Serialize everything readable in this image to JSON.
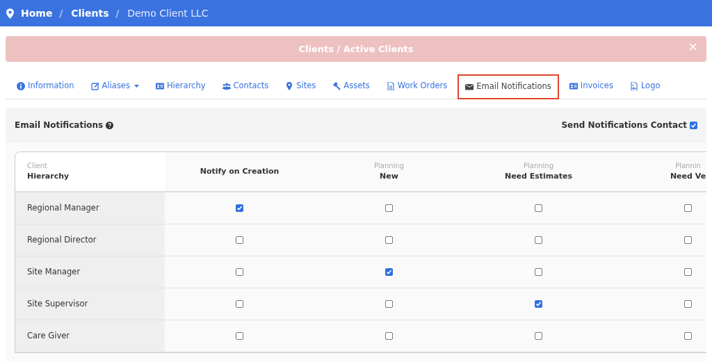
{
  "breadcrumb": [
    {
      "kind": "link",
      "text": "Home"
    },
    {
      "kind": "separator",
      "text": "/"
    },
    {
      "kind": "link",
      "text": "Clients"
    },
    {
      "kind": "separator",
      "text": "/"
    },
    {
      "kind": "current",
      "text": "Demo Client LLC"
    }
  ],
  "alert": {
    "text": "Clients / Active Clients",
    "close": "×"
  },
  "tabs": [
    {
      "label": "Information",
      "selected": false,
      "dropdown": false
    },
    {
      "label": "Aliases",
      "selected": false,
      "dropdown": true
    },
    {
      "label": "Hierarchy",
      "selected": false,
      "dropdown": false
    },
    {
      "label": "Contacts",
      "selected": false,
      "dropdown": false
    },
    {
      "label": "Sites",
      "selected": false,
      "dropdown": false
    },
    {
      "label": "Assets",
      "selected": false,
      "dropdown": false
    },
    {
      "label": "Work Orders",
      "selected": false,
      "dropdown": false
    },
    {
      "label": "Email Notifications",
      "selected": true,
      "dropdown": false
    },
    {
      "label": "Invoices",
      "selected": false,
      "dropdown": false
    },
    {
      "label": "Logo",
      "selected": false,
      "dropdown": false
    }
  ],
  "panel": {
    "title": "Email Notifications",
    "send_contact": {
      "label": "Send Notifications Contact",
      "checked": true
    }
  },
  "table": {
    "columns": [
      {
        "group": "Client",
        "label": "Hierarchy"
      },
      {
        "label": "Notify on Creation"
      },
      {
        "group": "Planning",
        "label": "New"
      },
      {
        "group": "Planning",
        "label": "Need Estimates"
      },
      {
        "group": "Plannin",
        "label": "Need Ve"
      }
    ],
    "rows": [
      {
        "name": "Regional Manager",
        "checks": [
          true,
          false,
          false,
          false
        ]
      },
      {
        "name": "Regional Director",
        "checks": [
          false,
          false,
          false,
          false
        ]
      },
      {
        "name": "Site Manager",
        "checks": [
          false,
          true,
          false,
          false
        ]
      },
      {
        "name": "Site Supervisor",
        "checks": [
          false,
          false,
          true,
          false
        ]
      },
      {
        "name": "Care Giver",
        "checks": [
          false,
          false,
          false,
          false
        ]
      }
    ]
  }
}
